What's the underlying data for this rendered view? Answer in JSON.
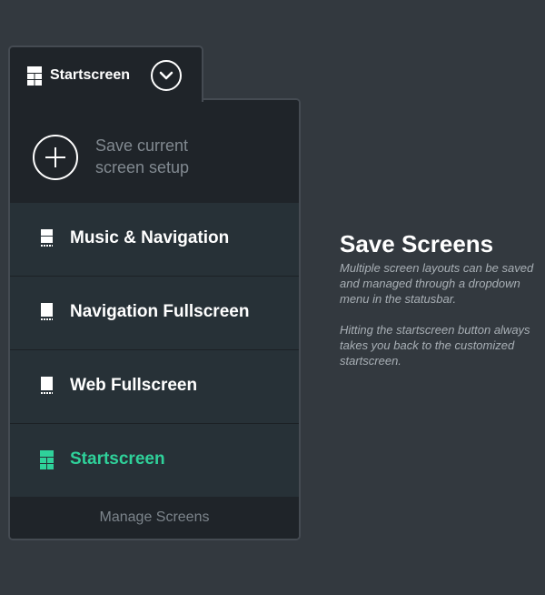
{
  "tab": {
    "label": "Startscreen",
    "icon": "startscreen-grid-icon",
    "dropdown_icon": "chevron-down-icon"
  },
  "save": {
    "icon": "plus-icon",
    "line1": "Save current",
    "line2": "screen setup"
  },
  "screens": [
    {
      "label": "Music & Navigation",
      "icon": "split-layout-icon",
      "active": false
    },
    {
      "label": "Navigation Fullscreen",
      "icon": "fullscreen-layout-icon",
      "active": false
    },
    {
      "label": "Web Fullscreen",
      "icon": "fullscreen-layout-icon",
      "active": false
    },
    {
      "label": "Startscreen",
      "icon": "startscreen-grid-icon",
      "active": true
    }
  ],
  "manage": {
    "label": "Manage Screens"
  },
  "info": {
    "title": "Save Screens",
    "paragraph1": "Multiple screen layouts can be saved and managed through a dropdown menu in the statusbar.",
    "paragraph2": "Hitting the startscreen button always takes you back to the customized startscreen."
  },
  "colors": {
    "background": "#33393f",
    "panel": "#1f2429",
    "item": "#273137",
    "accent": "#2fd19a",
    "muted_text": "#818990"
  }
}
